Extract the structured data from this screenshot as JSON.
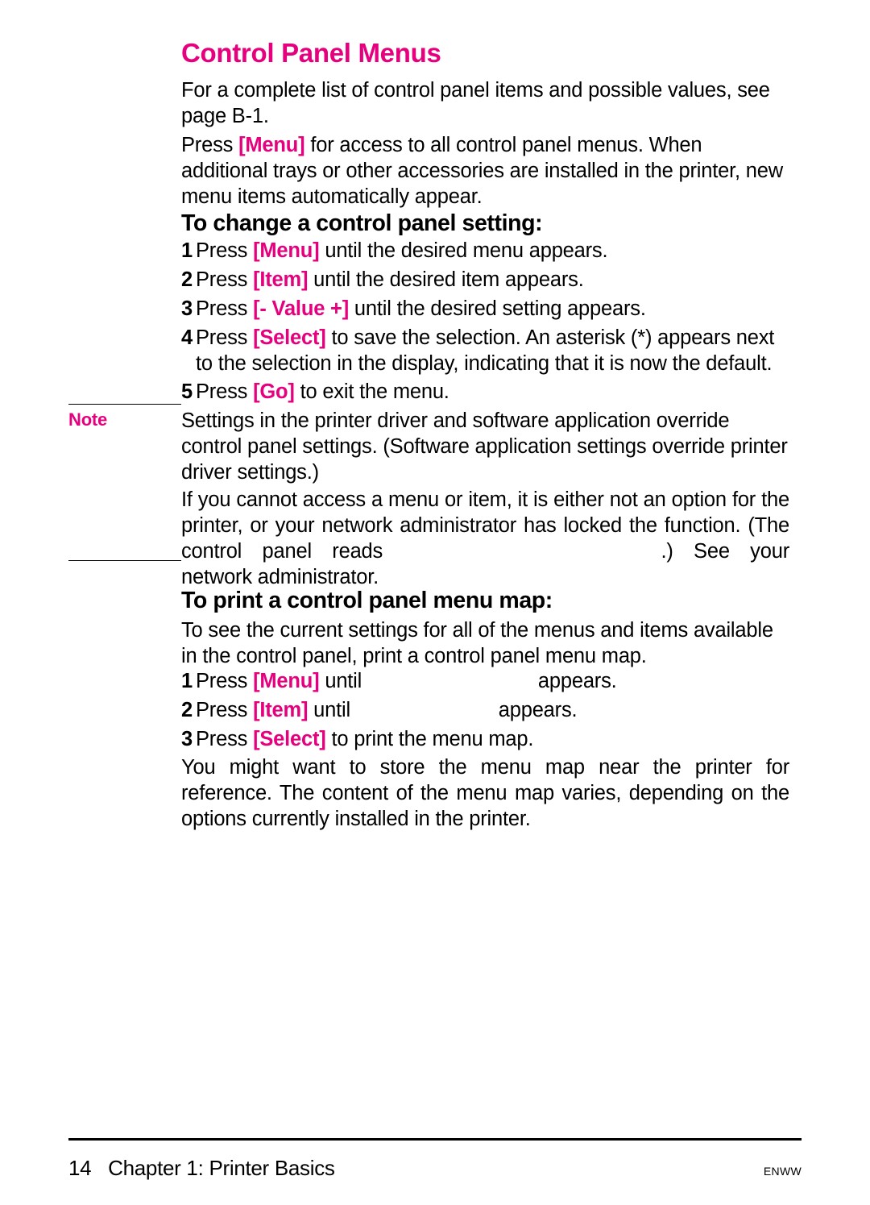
{
  "title": "Control Panel Menus",
  "intro1": {
    "p1_a": "For a complete list of control panel items and possible values, see page B-1.",
    "p2_a": "Press ",
    "p2_menu": "[Menu]",
    "p2_b": " for access to all control panel menus. When additional trays or other accessories are installed in the printer, new menu items automatically appear."
  },
  "h2a": "To change a control panel setting:",
  "steps_a": {
    "s1_a": "Press ",
    "s1_menu": "[Menu]",
    "s1_b": " until the desired menu appears.",
    "s2_a": "Press ",
    "s2_item": "[Item]",
    "s2_b": " until the desired item appears.",
    "s3_a": "Press ",
    "s3_val": "[- Value +]",
    "s3_b": " until the desired setting appears.",
    "s4_a": "Press ",
    "s4_sel": "[Select]",
    "s4_b": " to save the selection. An asterisk (*) appears next to the selection in the display, indicating that it is now the default.",
    "s5_a": "Press ",
    "s5_go": "[Go]",
    "s5_b": " to exit the menu."
  },
  "note_label": "Note",
  "note": {
    "p1": "Settings in the printer driver and software application override control panel settings. (Software application settings override printer driver settings.)",
    "p2_a": "If you cannot access a menu or item, it is either not an option for the printer, or your network administrator has locked the function. (The control panel reads ",
    "p2_b": ".) See your network administrator."
  },
  "h2b": "To print a control panel menu map:",
  "map_intro": "To see the current settings for all of the menus and items available in the control panel, print a control panel menu map.",
  "steps_b": {
    "s1_a": "Press ",
    "s1_menu": "[Menu]",
    "s1_b": " until ",
    "s1_gap": "",
    "s1_c": " appears.",
    "s2_a": "Press ",
    "s2_item": "[Item]",
    "s2_b": " until ",
    "s2_gap": "",
    "s2_c": " appears.",
    "s3_a": "Press ",
    "s3_sel": "[Select]",
    "s3_b": " to print the menu map."
  },
  "map_outro": "You might want to store the menu map near the printer for reference. The content of the menu map varies, depending on the options currently installed in the printer.",
  "footer": {
    "page_num": "14",
    "chapter": "Chapter 1:  Printer Basics",
    "right": "ENWW"
  }
}
